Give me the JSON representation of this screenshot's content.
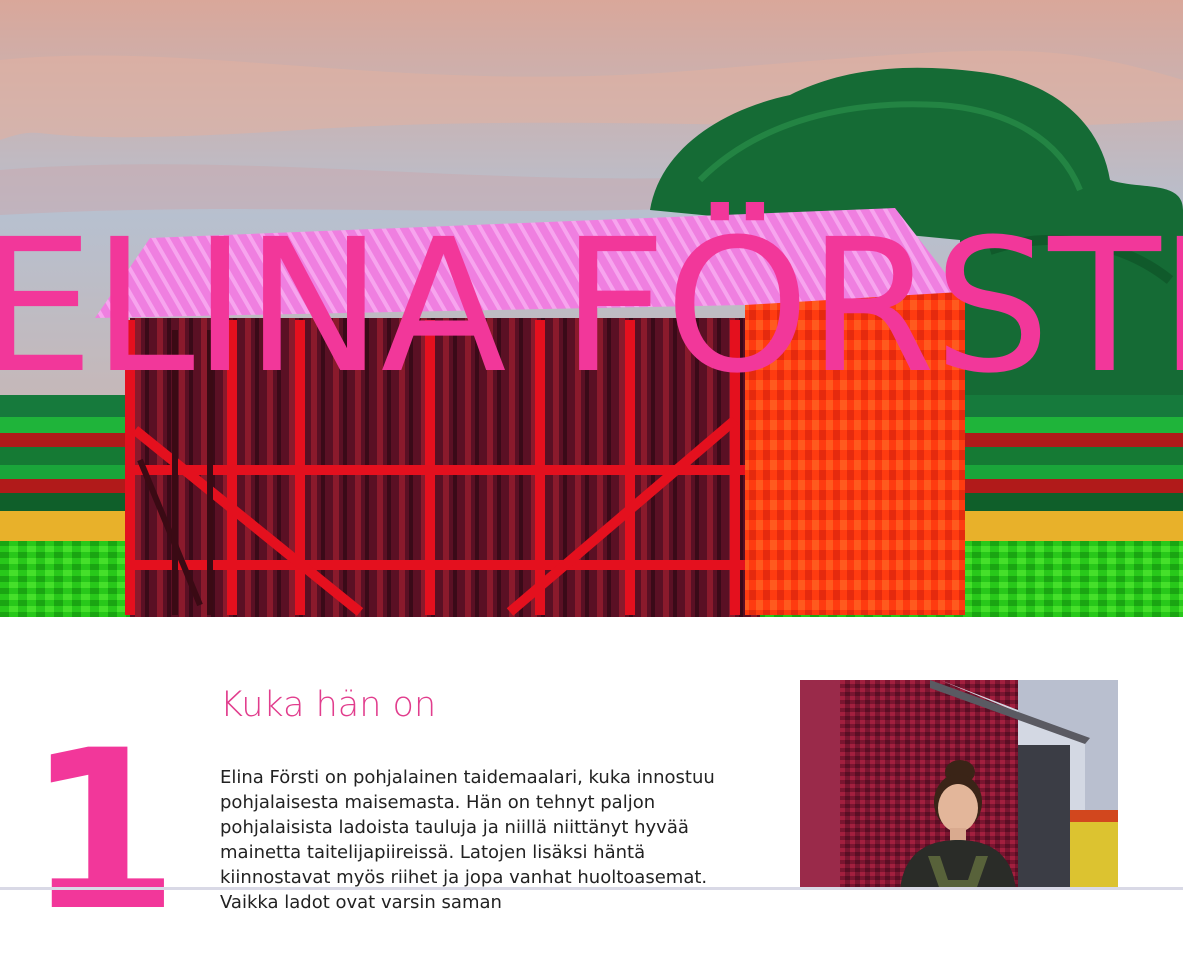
{
  "hero": {
    "title": "ELINA FÖRSTI",
    "painting_icon": "barn-painting-image"
  },
  "about": {
    "number": "1",
    "heading": "Kuka hän on",
    "text": "Elina Försti on pohjalainen taidemaalari, kuka innostuu pohjalaisesta maisemasta. Hän on tehnyt paljon pohjalaisista ladoista tauluja ja niillä niittänyt hyvää mainetta taitelijapiireissä. Latojen lisäksi häntä kiinnostavat myös riihet ja jopa vanhat huoltoasemat. Vaikka ladot ovat varsin saman",
    "portrait_icon": "artist-portrait-image"
  },
  "colors": {
    "accent": "#f2379a",
    "heading": "#e13d8d"
  }
}
